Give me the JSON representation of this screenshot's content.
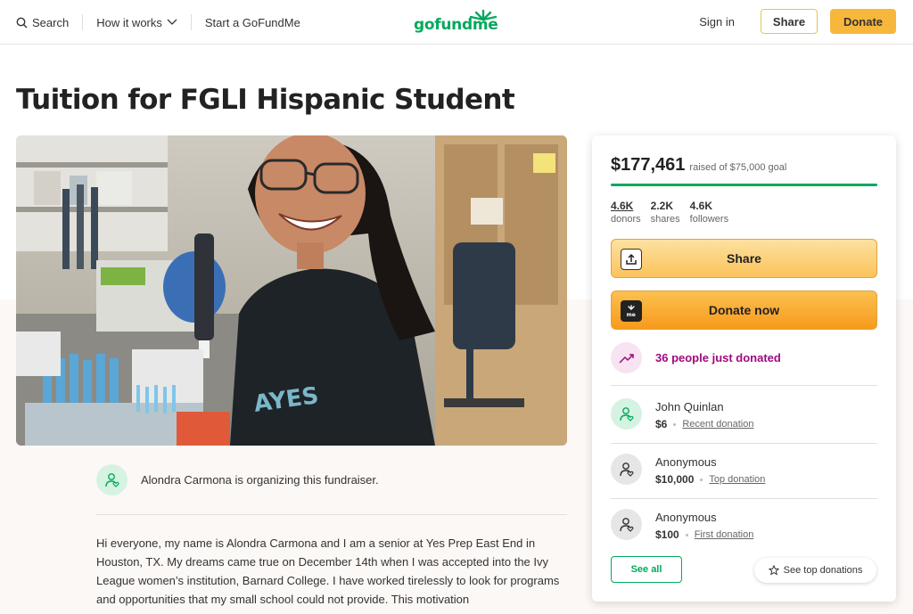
{
  "header": {
    "search_label": "Search",
    "how_it_works_label": "How it works",
    "start_label": "Start a GoFundMe",
    "logo_text": "gofundme",
    "signin_label": "Sign in",
    "share_label": "Share",
    "donate_label": "Donate"
  },
  "campaign": {
    "title": "Tuition for FGLI Hispanic Student",
    "organizer_text": "Alondra Carmona is organizing this fundraiser.",
    "story": "Hi everyone, my name is Alondra Carmona and I am a senior at Yes Prep East End in Houston, TX. My dreams came true on December 14th when I was accepted into the Ivy League women’s institution, Barnard College. I have worked tirelessly to look for programs and opportunities that my small school could not provide. This motivation"
  },
  "sidebar": {
    "raised_amount": "$177,461",
    "raised_goal": "raised of $75,000 goal",
    "progress_fraction": 1.0,
    "stats": [
      {
        "num": "4.6K",
        "label": "donors"
      },
      {
        "num": "2.2K",
        "label": "shares"
      },
      {
        "num": "4.6K",
        "label": "followers"
      }
    ],
    "share_label": "Share",
    "donate_now_label": "Donate now",
    "just_donated": "36 people just donated",
    "donors": [
      {
        "name": "John Quinlan",
        "amount": "$6",
        "tag": "Recent donation"
      },
      {
        "name": "Anonymous",
        "amount": "$10,000",
        "tag": "Top donation"
      },
      {
        "name": "Anonymous",
        "amount": "$100",
        "tag": "First donation"
      }
    ],
    "see_all_label": "See all",
    "see_top_label": "See top donations"
  },
  "colors": {
    "brand_green": "#02a95c",
    "donate_yellow": "#f6b73c",
    "trend_magenta": "#a0097e"
  }
}
